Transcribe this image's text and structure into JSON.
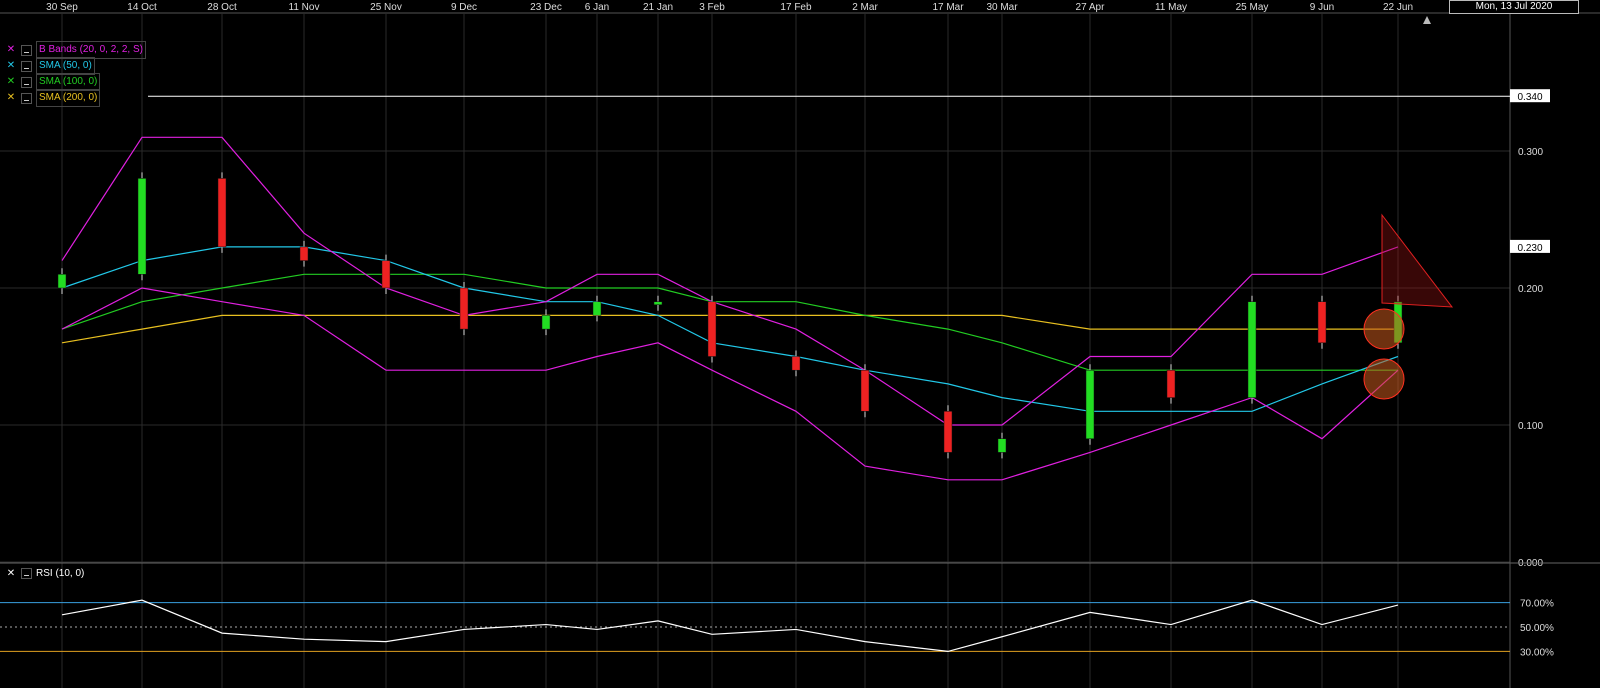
{
  "date_label": "Mon, 13 Jul 2020",
  "x_axis_dates": [
    "30 Sep",
    "14 Oct",
    "28 Oct",
    "11 Nov",
    "25 Nov",
    "9 Dec",
    "23 Dec",
    "6 Jan",
    "21 Jan",
    "3 Feb",
    "17 Feb",
    "2 Mar",
    "17 Mar",
    "30 Mar",
    "27 Apr",
    "11 May",
    "25 May",
    "9 Jun",
    "22 Jun"
  ],
  "legend": {
    "bbands": {
      "label": "B Bands (20, 0, 2, 2, S)",
      "color": "#e020e0"
    },
    "sma50": {
      "label": "SMA (50, 0)",
      "color": "#22c8e8"
    },
    "sma100": {
      "label": "SMA (100, 0)",
      "color": "#22cc22"
    },
    "sma200": {
      "label": "SMA (200, 0)",
      "color": "#e8c020"
    }
  },
  "rsi_legend": {
    "label": "RSI (10, 0)"
  },
  "price_axis_ticks": [
    "0.300",
    "0.200",
    "0.100",
    "0.000"
  ],
  "price_flags": {
    "high": "0.340",
    "last": "0.230"
  },
  "rsi_axis_ticks": [
    "70.00%",
    "50.00%",
    "30.00%"
  ],
  "chart_data": {
    "type": "candlestick",
    "ylim": [
      0,
      0.4
    ],
    "rsi_ylim": [
      0,
      100
    ],
    "x": [
      "30 Sep",
      "14 Oct",
      "28 Oct",
      "11 Nov",
      "25 Nov",
      "9 Dec",
      "23 Dec",
      "6 Jan",
      "21 Jan",
      "3 Feb",
      "17 Feb",
      "2 Mar",
      "17 Mar",
      "30 Mar",
      "27 Apr",
      "11 May",
      "25 May",
      "9 Jun",
      "22 Jun"
    ],
    "close": [
      0.21,
      0.28,
      0.23,
      0.22,
      0.2,
      0.17,
      0.18,
      0.19,
      0.19,
      0.15,
      0.14,
      0.11,
      0.08,
      0.09,
      0.14,
      0.12,
      0.19,
      0.16,
      0.19
    ],
    "bb_upper": [
      0.22,
      0.31,
      0.31,
      0.24,
      0.2,
      0.18,
      0.19,
      0.21,
      0.21,
      0.19,
      0.17,
      0.14,
      0.1,
      0.1,
      0.15,
      0.15,
      0.21,
      0.21,
      0.23
    ],
    "bb_lower": [
      0.17,
      0.2,
      0.19,
      0.18,
      0.14,
      0.14,
      0.14,
      0.15,
      0.16,
      0.14,
      0.11,
      0.07,
      0.06,
      0.06,
      0.08,
      0.1,
      0.12,
      0.09,
      0.14
    ],
    "sma50": [
      0.2,
      0.22,
      0.23,
      0.23,
      0.22,
      0.2,
      0.19,
      0.19,
      0.18,
      0.16,
      0.15,
      0.14,
      0.13,
      0.12,
      0.11,
      0.11,
      0.11,
      0.13,
      0.15
    ],
    "sma100": [
      0.17,
      0.19,
      0.2,
      0.21,
      0.21,
      0.21,
      0.2,
      0.2,
      0.2,
      0.19,
      0.19,
      0.18,
      0.17,
      0.16,
      0.14,
      0.14,
      0.14,
      0.14,
      0.14
    ],
    "sma200": [
      0.16,
      0.17,
      0.18,
      0.18,
      0.18,
      0.18,
      0.18,
      0.18,
      0.18,
      0.18,
      0.18,
      0.18,
      0.18,
      0.18,
      0.17,
      0.17,
      0.17,
      0.17,
      0.17
    ],
    "rsi": [
      60,
      72,
      45,
      40,
      38,
      48,
      52,
      48,
      55,
      44,
      48,
      38,
      30,
      42,
      62,
      52,
      72,
      52,
      68
    ],
    "rsi_levels": [
      70,
      50,
      30
    ],
    "high_line": 0.34
  }
}
